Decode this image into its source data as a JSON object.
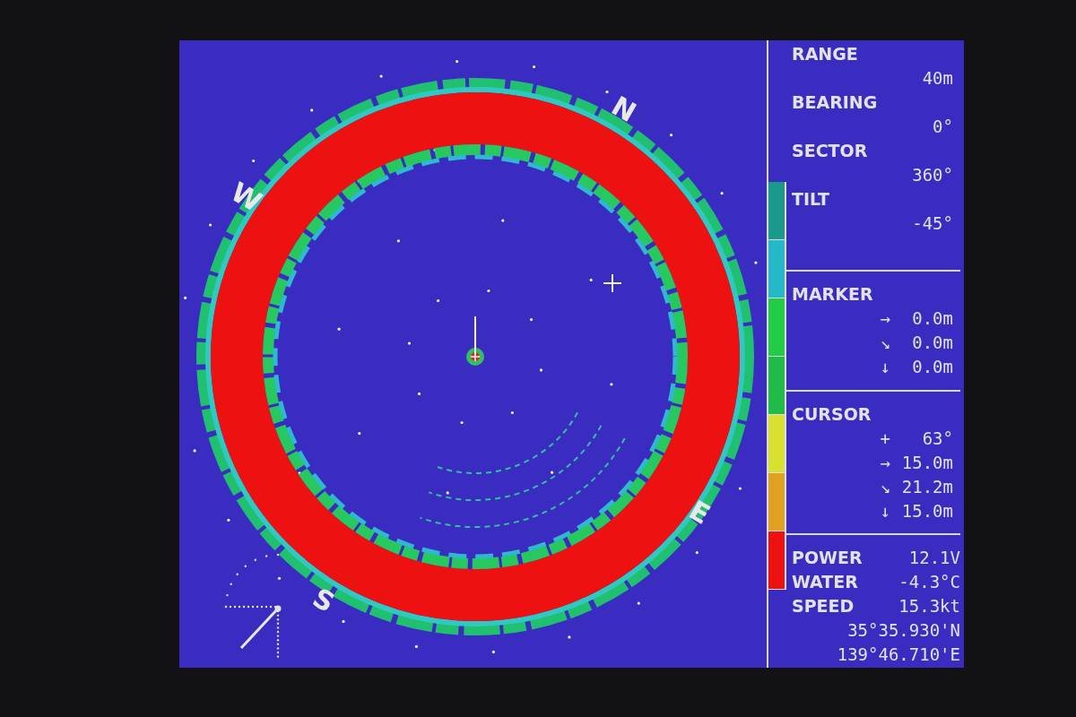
{
  "sonar": {
    "compass": [
      {
        "label": "N"
      },
      {
        "label": "E"
      },
      {
        "label": "S"
      },
      {
        "label": "W"
      }
    ]
  },
  "color_scale": [
    {
      "color": "#1b9a8c"
    },
    {
      "color": "#25b8c8"
    },
    {
      "color": "#22cc44"
    },
    {
      "color": "#20bb48"
    },
    {
      "color": "#d8e030"
    },
    {
      "color": "#e0a020"
    },
    {
      "color": "#ee1111"
    }
  ],
  "settings": [
    {
      "label": "RANGE",
      "value": "40m"
    },
    {
      "label": "BEARING",
      "value": "0°"
    },
    {
      "label": "SECTOR",
      "value": "360°"
    },
    {
      "label": "TILT",
      "value": "-45°"
    }
  ],
  "marker": {
    "title": "MARKER",
    "rows": [
      {
        "symbol": "→",
        "value": "0.0m"
      },
      {
        "symbol": "↘",
        "value": "0.0m"
      },
      {
        "symbol": "↓",
        "value": "0.0m"
      }
    ]
  },
  "cursor": {
    "title": "CURSOR",
    "rows": [
      {
        "symbol": "+",
        "value": "63°"
      },
      {
        "symbol": "→",
        "value": "15.0m"
      },
      {
        "symbol": "↘",
        "value": "21.2m"
      },
      {
        "symbol": "↓",
        "value": "15.0m"
      }
    ]
  },
  "status": [
    {
      "label": "POWER",
      "value": "12.1V"
    },
    {
      "label": "WATER",
      "value": "-4.3°C"
    },
    {
      "label": "SPEED",
      "value": "15.3kt"
    }
  ],
  "position": [
    "35°35.930'N",
    "139°46.710'E"
  ]
}
